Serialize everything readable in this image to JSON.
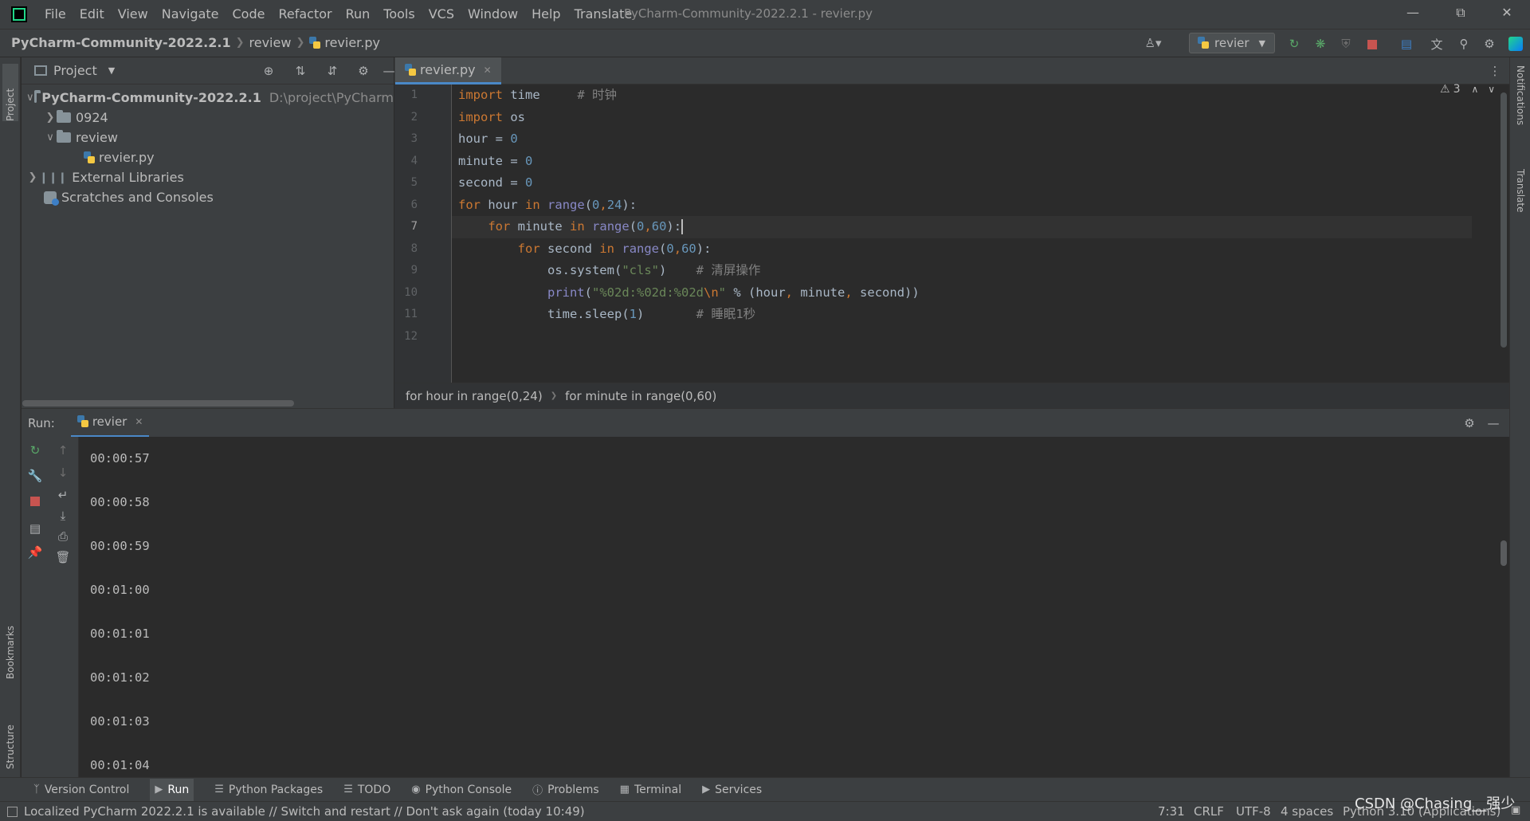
{
  "app": {
    "title": "PyCharm-Community-2022.2.1 - revier.py",
    "menu": [
      "File",
      "Edit",
      "View",
      "Navigate",
      "Code",
      "Refactor",
      "Run",
      "Tools",
      "VCS",
      "Window",
      "Help",
      "Translate"
    ]
  },
  "navbar": {
    "crumbs": [
      "PyCharm-Community-2022.2.1",
      "review",
      "revier.py"
    ],
    "run_config": "revier"
  },
  "left_strip": {
    "project": "Project",
    "bookmarks": "Bookmarks",
    "structure": "Structure"
  },
  "right_strip": {
    "notifications": "Notifications",
    "translate": "Translate"
  },
  "project": {
    "header": "Project",
    "root": {
      "name": "PyCharm-Community-2022.2.1",
      "path": "D:\\project\\PyCharm"
    },
    "items": [
      {
        "name": "0924"
      },
      {
        "name": "review"
      },
      {
        "name": "revier.py"
      },
      {
        "name": "External Libraries"
      },
      {
        "name": "Scratches and Consoles"
      }
    ]
  },
  "editor": {
    "tab": "revier.py",
    "warnings": "3",
    "line_numbers": [
      "1",
      "2",
      "3",
      "4",
      "5",
      "6",
      "7",
      "8",
      "9",
      "10",
      "11",
      "12"
    ],
    "breadcrumbs": [
      "for hour in range(0,24)",
      "for minute in range(0,60)"
    ]
  },
  "run": {
    "label": "Run:",
    "tab": "revier",
    "output": [
      "\u000100:00:57",
      "\u000100:00:58",
      "\u000100:00:59",
      "\u000100:01:00",
      "\u000100:01:01",
      "\u000100:01:02",
      "\u000100:01:03",
      "\u000100:01:04"
    ]
  },
  "bottom_bar": {
    "items": [
      "Version Control",
      "Run",
      "Python Packages",
      "TODO",
      "Python Console",
      "Problems",
      "Terminal",
      "Services"
    ]
  },
  "status": {
    "message": "Localized PyCharm 2022.2.1 is available // Switch and restart // Don't ask again (today 10:49)",
    "position": "7:31",
    "line_sep": "CRLF",
    "encoding": "UTF-8",
    "indent": "4 spaces",
    "interpreter": "Python 3.10 (Applications)",
    "watermark": "CSDN @Chasing__强少"
  },
  "colors": {
    "accent": "#4a88c7",
    "keyword": "#cc7832",
    "number": "#6897bb",
    "string": "#6a8759",
    "comment": "#808080"
  }
}
